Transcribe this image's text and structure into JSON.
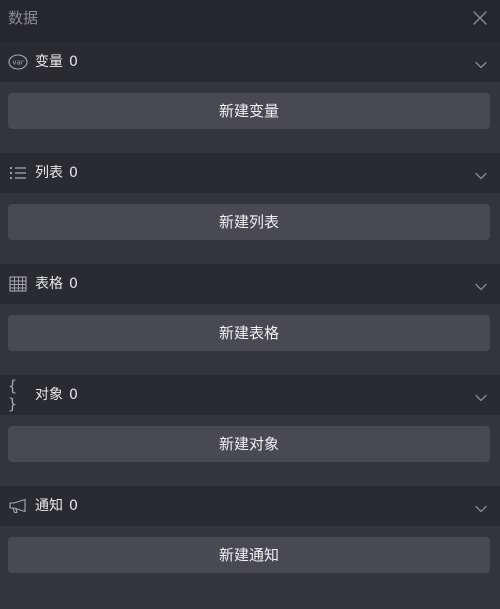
{
  "panel": {
    "title": "数据",
    "close_icon": "close-icon"
  },
  "sections": [
    {
      "name": "变量",
      "count": "0",
      "icon": "variable-icon",
      "icon_text": "var",
      "button": "新建变量",
      "chevron": "chevron-down-icon"
    },
    {
      "name": "列表",
      "count": "0",
      "icon": "list-icon",
      "button": "新建列表",
      "chevron": "chevron-down-icon"
    },
    {
      "name": "表格",
      "count": "0",
      "icon": "table-icon",
      "button": "新建表格",
      "chevron": "chevron-down-icon"
    },
    {
      "name": "对象",
      "count": "0",
      "icon": "braces-icon",
      "icon_text": "{ }",
      "button": "新建对象",
      "chevron": "chevron-down-icon"
    },
    {
      "name": "通知",
      "count": "0",
      "icon": "megaphone-icon",
      "button": "新建通知",
      "chevron": "chevron-down-icon"
    }
  ],
  "colors": {
    "background": "#34353b",
    "titlebar": "#26272c",
    "section_header": "#2a2b30",
    "button": "#494a51",
    "text": "#e8e8ec",
    "muted": "#8b8c92"
  }
}
